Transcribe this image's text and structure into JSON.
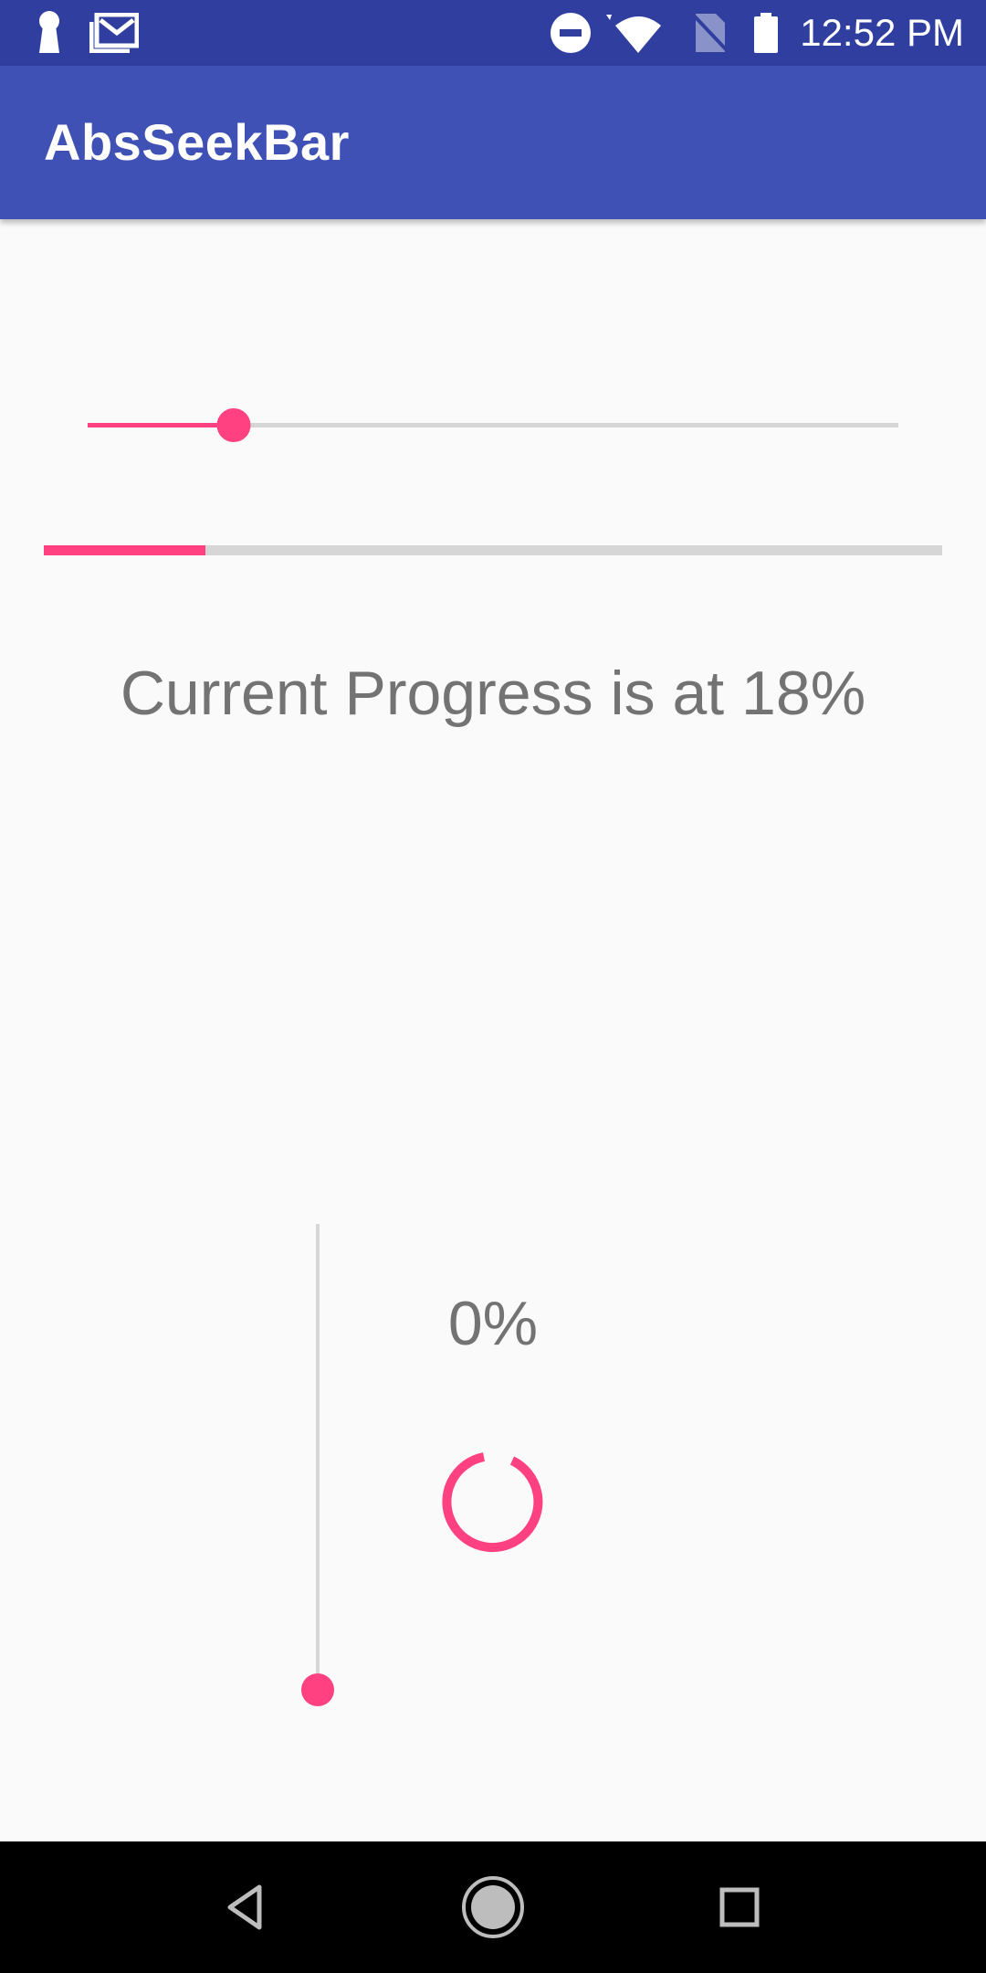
{
  "status_bar": {
    "time": "12:52 PM",
    "icons": [
      "keyhole-icon",
      "gallery-mail-icon",
      "do-not-disturb-icon",
      "wifi-icon",
      "no-sim-icon",
      "battery-icon"
    ]
  },
  "app_bar": {
    "title": "AbsSeekBar"
  },
  "seekbar_horizontal": {
    "progress_fraction": 0.18
  },
  "progress_bar_horizontal": {
    "progress_fraction": 0.18
  },
  "progress_text": "Current Progress is at 18%",
  "seekbar_vertical": {
    "progress_fraction": 0.0
  },
  "percent_text": "0%",
  "spinner": {
    "icon": "loading-spinner-icon"
  },
  "nav_bar": {
    "icons": [
      "back-icon",
      "home-icon",
      "recents-icon"
    ]
  },
  "colors": {
    "status_bar": "#303f9f",
    "app_bar": "#3f51b5",
    "accent": "#ff4081",
    "track": "#d6d6d6",
    "text_secondary": "#737373",
    "background": "#fafafa"
  }
}
